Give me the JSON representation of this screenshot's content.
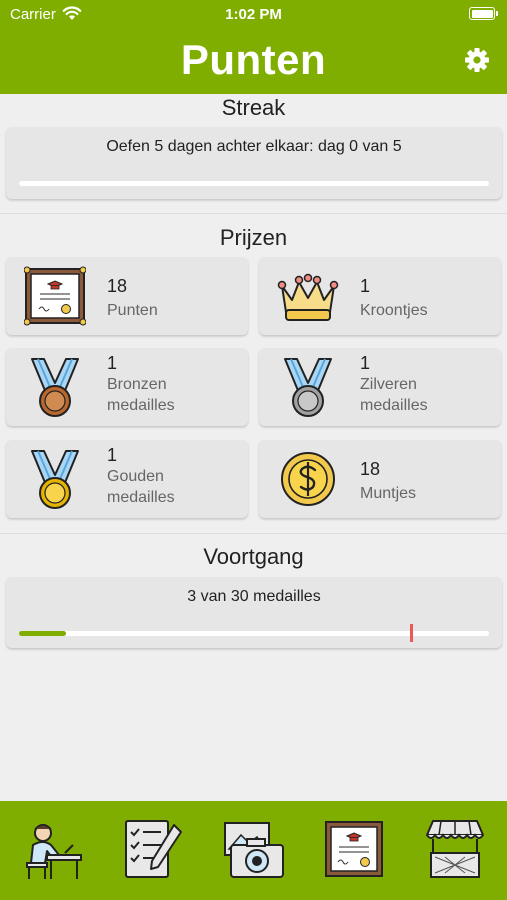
{
  "status": {
    "carrier": "Carrier",
    "time": "1:02 PM"
  },
  "header": {
    "title": "Punten",
    "settings_icon": "gear-icon"
  },
  "streak": {
    "title": "Streak",
    "text": "Oefen 5 dagen achter elkaar: dag 0 van 5",
    "progress": 0
  },
  "prizes": {
    "title": "Prijzen",
    "items": [
      {
        "count": "18",
        "label": "Punten",
        "icon": "certificate-icon"
      },
      {
        "count": "1",
        "label": "Kroontjes",
        "icon": "crown-icon"
      },
      {
        "count": "1",
        "label": "Bronzen medailles",
        "icon": "bronze-medal-icon"
      },
      {
        "count": "1",
        "label": "Zilveren medailles",
        "icon": "silver-medal-icon"
      },
      {
        "count": "1",
        "label": "Gouden medailles",
        "icon": "gold-medal-icon"
      },
      {
        "count": "18",
        "label": "Muntjes",
        "icon": "coin-icon"
      }
    ]
  },
  "progress": {
    "title": "Voortgang",
    "text": "3 van 30 medailles",
    "value": 3,
    "total": 30,
    "marker_value": 25
  },
  "colors": {
    "accent": "#7fae00",
    "marker": "#e85a5a",
    "background": "#efefef",
    "card": "#e6e6e6"
  },
  "tabs": [
    {
      "icon": "student-desk-icon"
    },
    {
      "icon": "checklist-icon"
    },
    {
      "icon": "camera-icon"
    },
    {
      "icon": "certificate-icon"
    },
    {
      "icon": "shop-stall-icon"
    }
  ]
}
